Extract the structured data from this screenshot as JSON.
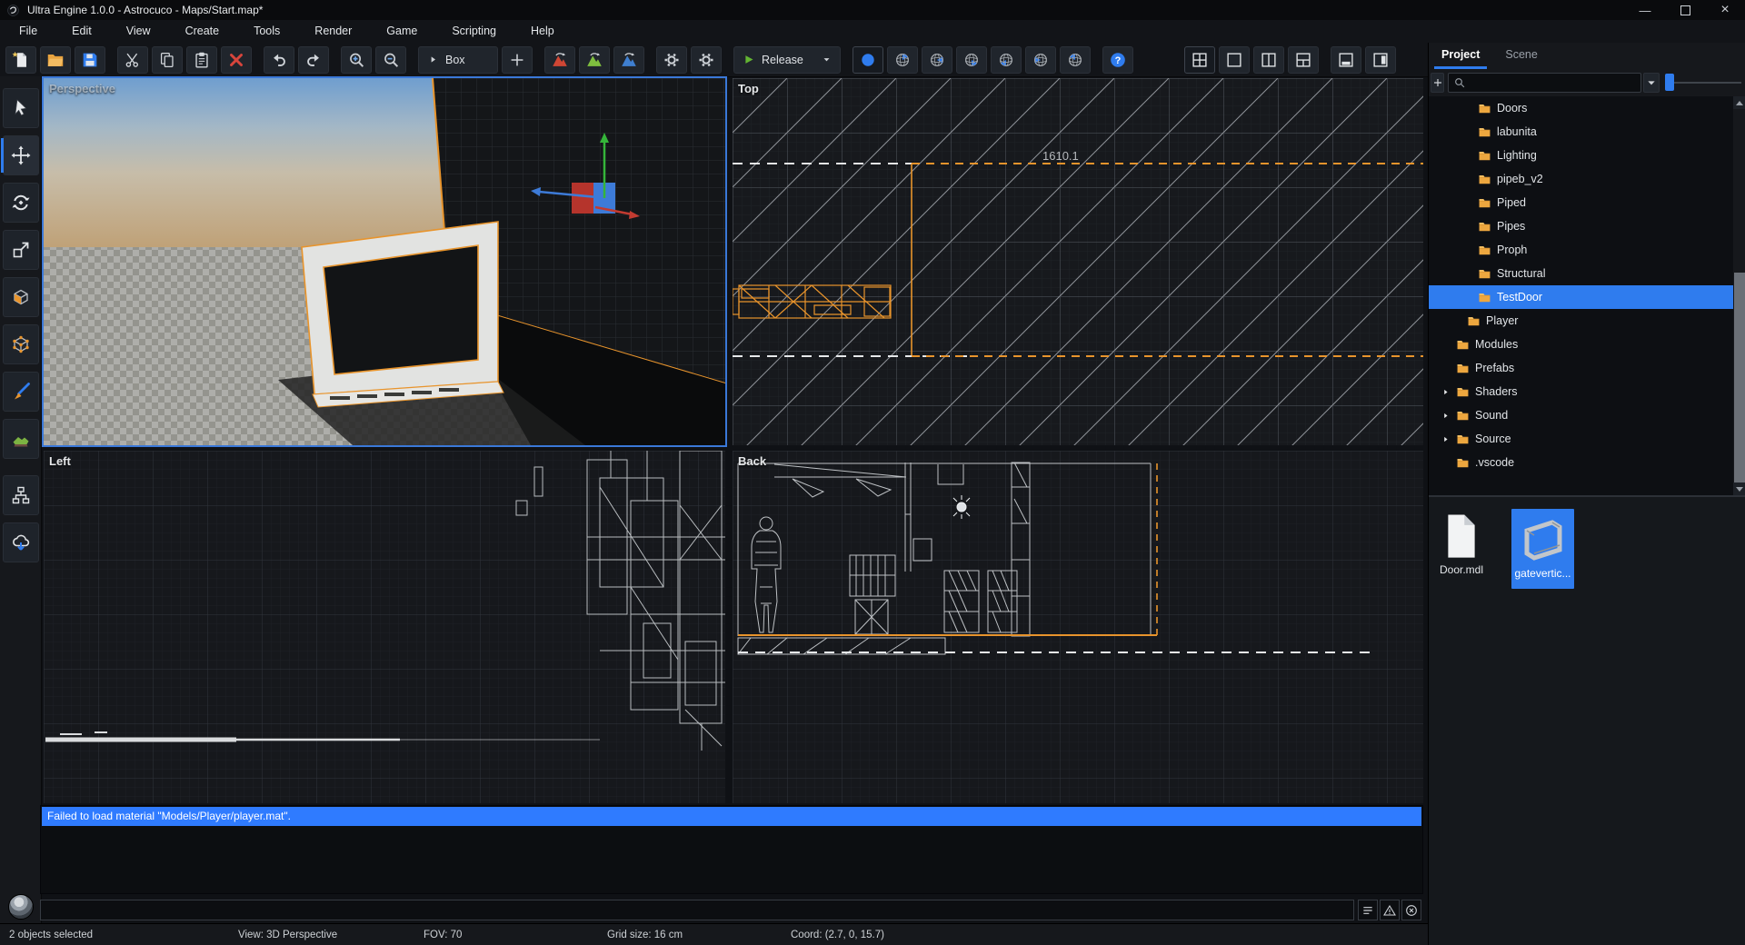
{
  "window": {
    "title": "Ultra Engine 1.0.0 - Astrocuco - Maps/Start.map*",
    "controls": [
      {
        "name": "minimize"
      },
      {
        "name": "maximize"
      },
      {
        "name": "close"
      }
    ]
  },
  "menu": {
    "items": [
      "File",
      "Edit",
      "View",
      "Create",
      "Tools",
      "Render",
      "Game",
      "Scripting",
      "Help"
    ]
  },
  "toolbar": {
    "groups": [
      {
        "name": "file",
        "items": [
          {
            "name": "new-map-button",
            "icon": "new-file"
          },
          {
            "name": "open-map-button",
            "icon": "open-folder"
          },
          {
            "name": "save-map-button",
            "icon": "save"
          }
        ]
      },
      {
        "name": "clipboard",
        "items": [
          {
            "name": "cut-button",
            "icon": "cut"
          },
          {
            "name": "copy-button",
            "icon": "copy"
          },
          {
            "name": "paste-button",
            "icon": "paste"
          },
          {
            "name": "delete-button",
            "icon": "delete"
          }
        ]
      },
      {
        "name": "history",
        "items": [
          {
            "name": "undo-button",
            "icon": "undo"
          },
          {
            "name": "redo-button",
            "icon": "redo"
          }
        ]
      },
      {
        "name": "zoom",
        "items": [
          {
            "name": "zoom-in-button",
            "icon": "zoom-in"
          },
          {
            "name": "zoom-out-button",
            "icon": "zoom-out"
          }
        ]
      },
      {
        "name": "primitive",
        "items": [
          {
            "name": "primitive-dropdown",
            "icon": "play-small",
            "label": "Box",
            "type": "drop"
          },
          {
            "name": "add-primitive-button",
            "icon": "plus"
          }
        ]
      },
      {
        "name": "terrain",
        "items": [
          {
            "name": "terrain-red-button",
            "icon": "terrain-red"
          },
          {
            "name": "terrain-green-button",
            "icon": "terrain-green"
          },
          {
            "name": "terrain-blue-button",
            "icon": "terrain-blue"
          }
        ]
      },
      {
        "name": "settings",
        "items": [
          {
            "name": "settings-button",
            "icon": "gear"
          },
          {
            "name": "build-settings-button",
            "icon": "gear"
          }
        ]
      },
      {
        "name": "run",
        "items": [
          {
            "name": "run-dropdown",
            "icon": "play-green",
            "label": "Release",
            "type": "drop2"
          }
        ]
      },
      {
        "name": "render-modes",
        "items": [
          {
            "name": "render-mode-solid-button",
            "icon": "sphere-solid",
            "active": true
          },
          {
            "name": "render-mode-2-button",
            "icon": "sphere-1"
          },
          {
            "name": "render-mode-3-button",
            "icon": "sphere-2"
          },
          {
            "name": "render-mode-4-button",
            "icon": "sphere-3"
          },
          {
            "name": "render-mode-5-button",
            "icon": "sphere-4"
          },
          {
            "name": "render-mode-6-button",
            "icon": "sphere-5"
          },
          {
            "name": "render-mode-7-button",
            "icon": "sphere-6"
          }
        ]
      },
      {
        "name": "help",
        "items": [
          {
            "name": "help-button",
            "icon": "help"
          }
        ]
      },
      {
        "name": "layouts",
        "right": true,
        "items": [
          {
            "name": "layout-quad-button",
            "icon": "layout-quad",
            "active": true
          },
          {
            "name": "layout-single-button",
            "icon": "layout-single"
          },
          {
            "name": "layout-vsplit-button",
            "icon": "layout-vsplit"
          },
          {
            "name": "layout-tsplit-button",
            "icon": "layout-tsplit"
          }
        ]
      },
      {
        "name": "panels",
        "items": [
          {
            "name": "toggle-console-panel-button",
            "icon": "panel-bottom"
          },
          {
            "name": "toggle-side-panel-button",
            "icon": "panel-right"
          }
        ]
      }
    ]
  },
  "sidebar": {
    "tools": [
      {
        "name": "select-tool",
        "icon": "cursor"
      },
      {
        "name": "move-tool",
        "icon": "move",
        "active": true
      },
      {
        "name": "rotate-tool",
        "icon": "rotate"
      },
      {
        "name": "scale-tool",
        "icon": "scale"
      },
      {
        "name": "face-select-tool",
        "icon": "cube-face"
      },
      {
        "name": "object-select-tool",
        "icon": "cube-vertex"
      },
      {
        "name": "paint-tool",
        "icon": "brush"
      },
      {
        "name": "terrain-tool",
        "icon": "terrain-tool"
      },
      {
        "name": "hierarchy-tool",
        "icon": "hierarchy",
        "gap": true
      },
      {
        "name": "download-tool",
        "icon": "cloud-down"
      }
    ]
  },
  "viewports": {
    "perspective": "Perspective",
    "top": "Top",
    "left": "Left",
    "back": "Back",
    "top_measurement": "1610.1"
  },
  "right_panel": {
    "tabs": [
      {
        "label": "Project",
        "active": true
      },
      {
        "label": "Scene"
      }
    ],
    "search": {
      "placeholder": ""
    },
    "tree": [
      {
        "label": "Doors",
        "depth": 3
      },
      {
        "label": "labunita",
        "depth": 3
      },
      {
        "label": "Lighting",
        "depth": 3
      },
      {
        "label": "pipeb_v2",
        "depth": 3
      },
      {
        "label": "Piped",
        "depth": 3
      },
      {
        "label": "Pipes",
        "depth": 3
      },
      {
        "label": "Proph",
        "depth": 3
      },
      {
        "label": "Structural",
        "depth": 3
      },
      {
        "label": "TestDoor",
        "depth": 3,
        "selected": true
      },
      {
        "label": "Player",
        "depth": 2
      },
      {
        "label": "Modules",
        "depth": 1
      },
      {
        "label": "Prefabs",
        "depth": 1
      },
      {
        "label": "Shaders",
        "depth": 1,
        "expandable": true
      },
      {
        "label": "Sound",
        "depth": 1,
        "expandable": true
      },
      {
        "label": "Source",
        "depth": 1,
        "expandable": true
      },
      {
        "label": ".vscode",
        "depth": 1
      }
    ],
    "files": [
      {
        "label": "Door.mdl",
        "kind": "document"
      },
      {
        "label": "gatevertic...",
        "kind": "model",
        "selected": true
      }
    ]
  },
  "console": {
    "message": "Failed to load material \"Models/Player/player.mat\".",
    "buttons": [
      {
        "name": "log-list-button",
        "icon": "console-lines"
      },
      {
        "name": "log-warnings-button",
        "icon": "console-warn"
      },
      {
        "name": "log-clear-button",
        "icon": "console-clear"
      }
    ]
  },
  "status": {
    "items": [
      {
        "name": "selection-count",
        "text": "2 objects selected"
      },
      {
        "name": "view-mode",
        "text": "View: 3D Perspective"
      },
      {
        "name": "fov",
        "text": "FOV: 70"
      },
      {
        "name": "grid-size",
        "text": "Grid size: 16 cm"
      },
      {
        "name": "coordinates",
        "text": "Coord: (2.7, 0, 15.7)"
      }
    ]
  },
  "colors": {
    "accent": "#2f7cee",
    "selection_orange": "#e8942c",
    "console_info": "#2f7bff",
    "folder": "#eda73f"
  }
}
